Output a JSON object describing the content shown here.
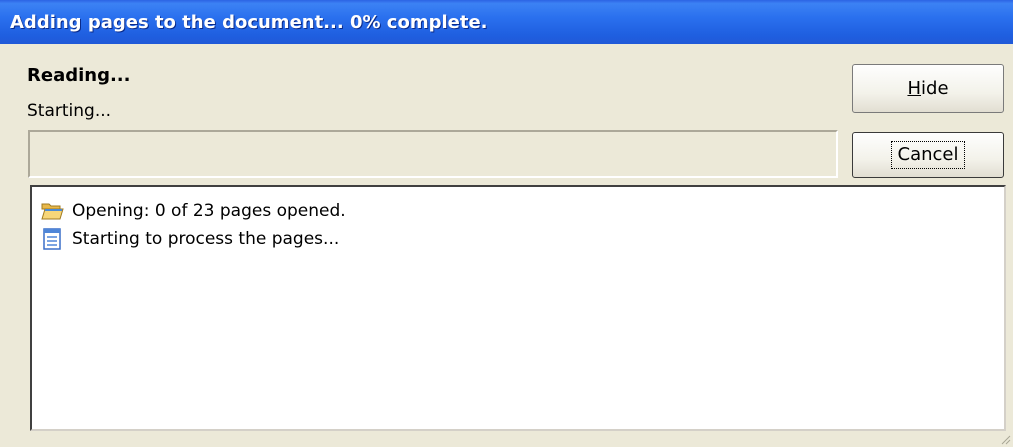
{
  "window": {
    "title": "Adding pages to the document... 0% complete."
  },
  "task": {
    "heading": "Reading...",
    "status": "Starting...",
    "progress_percent": 0
  },
  "buttons": {
    "hide": {
      "label_prefix": "",
      "mnemonic": "H",
      "label_suffix": "ide"
    },
    "cancel": {
      "label": "Cancel"
    }
  },
  "log": {
    "items": [
      {
        "icon": "open-folder-icon",
        "text": "Opening: 0 of 23 pages opened."
      },
      {
        "icon": "document-page-icon",
        "text": "Starting to process the pages..."
      }
    ]
  },
  "colors": {
    "titlebar": "#2a70ee",
    "background": "#ece9d8",
    "progress_fill": "#2f9a33"
  }
}
